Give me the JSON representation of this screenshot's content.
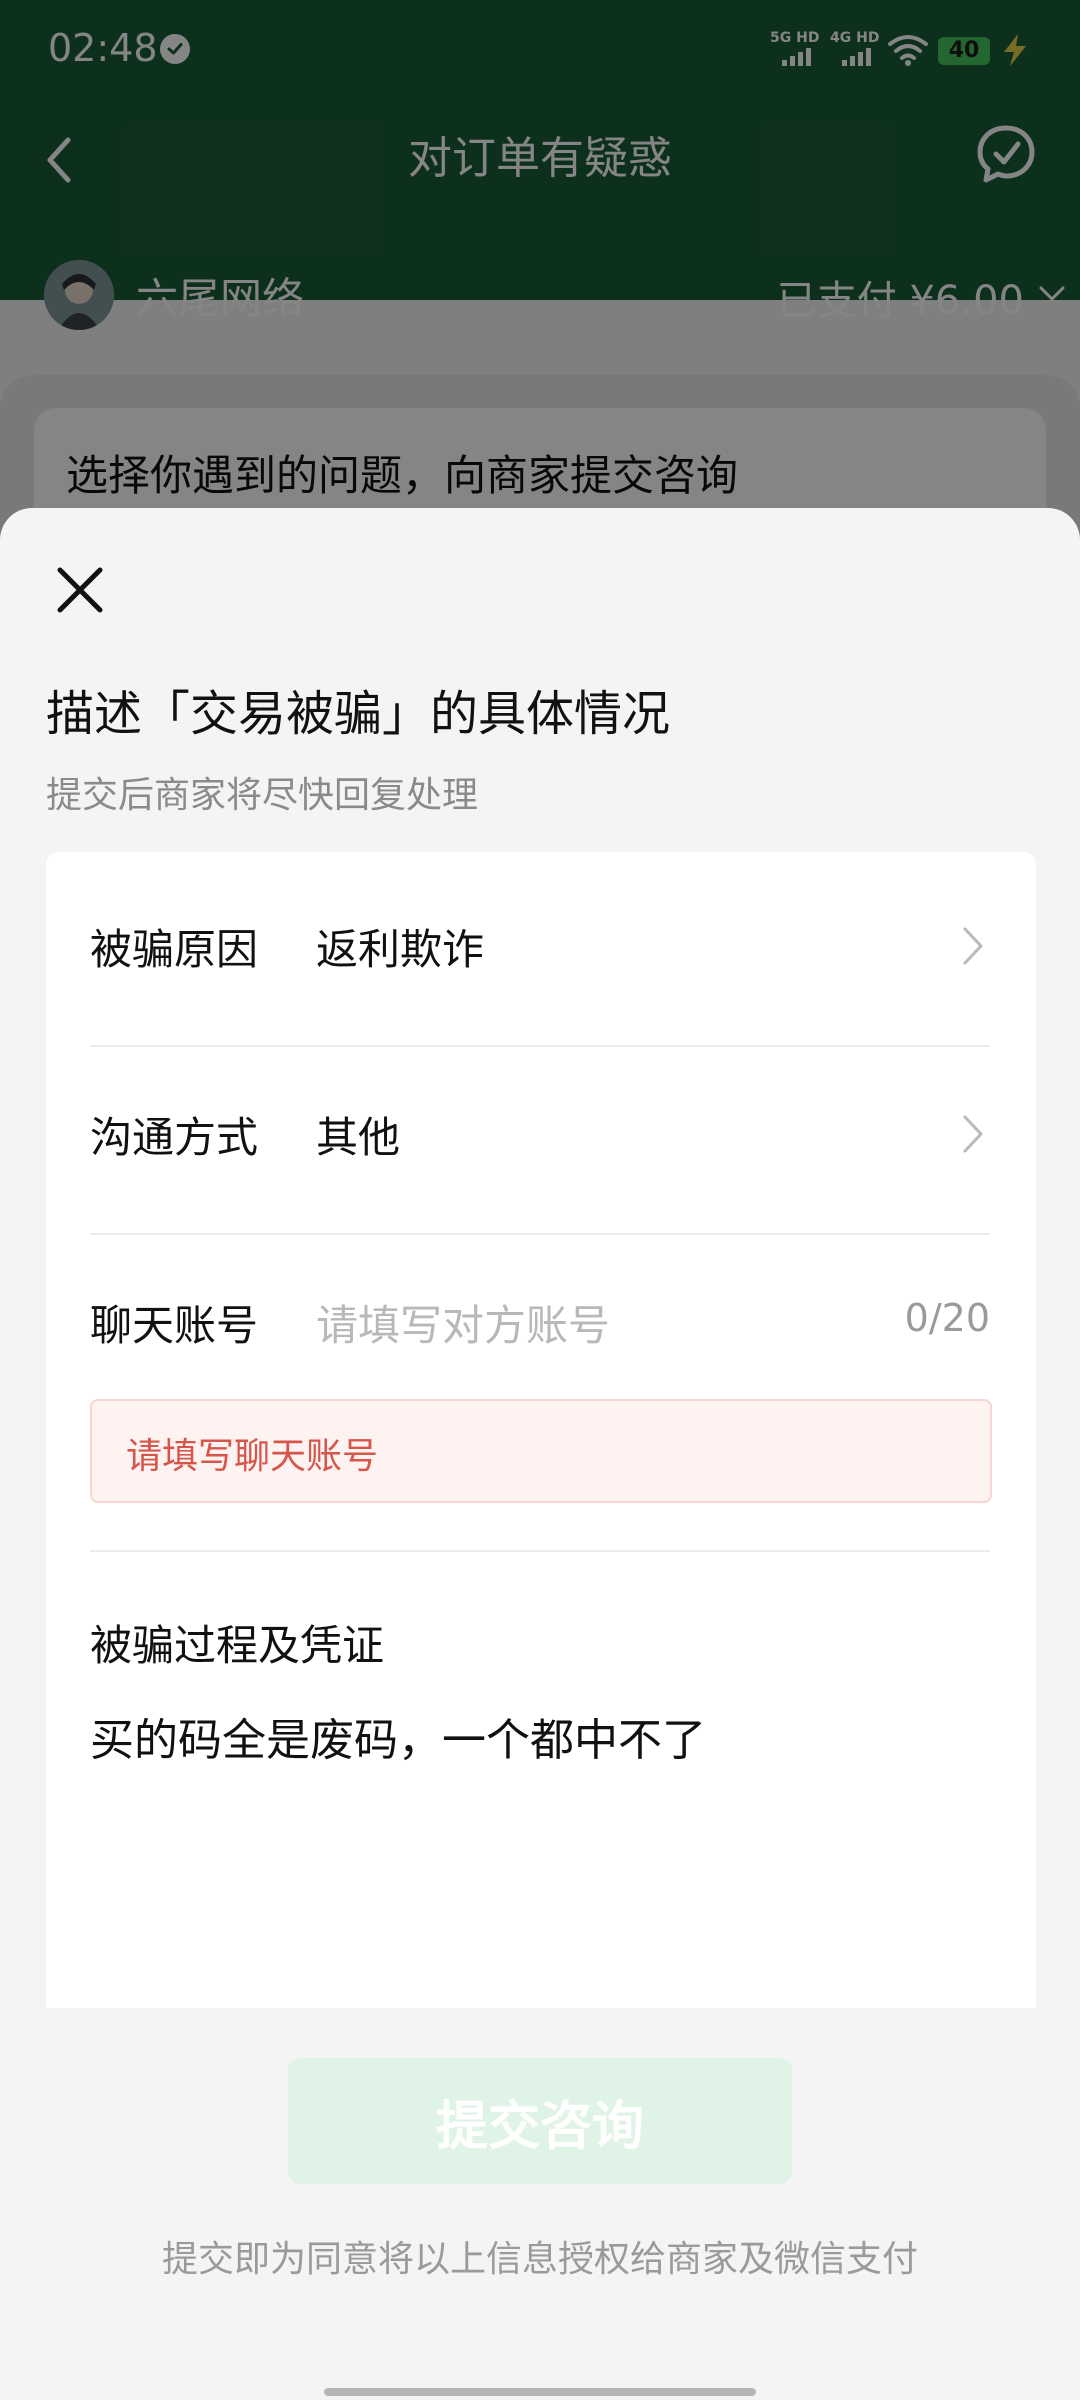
{
  "status_bar": {
    "time": "02:48",
    "sim1": "5G HD",
    "sim2": "4G HD",
    "battery": "40"
  },
  "header": {
    "title": "对订单有疑惑",
    "merchant_name": "六尾网络",
    "paid_amount": "已支付 ¥6.00"
  },
  "background_card": {
    "prompt": "选择你遇到的问题，向商家提交咨询"
  },
  "sheet": {
    "title": "描述「交易被骗」的具体情况",
    "subtitle": "提交后商家将尽快回复处理",
    "fields": {
      "reason": {
        "label": "被骗原因",
        "value": "返利欺诈"
      },
      "method": {
        "label": "沟通方式",
        "value": "其他"
      },
      "account": {
        "label": "聊天账号",
        "placeholder": "请填写对方账号",
        "counter": "0/20",
        "error": "请填写聊天账号"
      },
      "process": {
        "label": "被骗过程及凭证",
        "value": "买的码全是废码，一个都中不了"
      }
    },
    "submit_label": "提交咨询",
    "agreement": "提交即为同意将以上信息授权给商家及微信支付"
  },
  "colors": {
    "brand_green": "#1a5c38",
    "disabled_button": "#dff3e6",
    "error_text": "#d6564b"
  },
  "icons": [
    "check-circle-icon",
    "signal-icon",
    "wifi-icon",
    "battery-icon",
    "charging-bolt-icon",
    "back-arrow-icon",
    "chat-check-icon",
    "chevron-down-icon",
    "close-icon",
    "chevron-right-icon"
  ]
}
